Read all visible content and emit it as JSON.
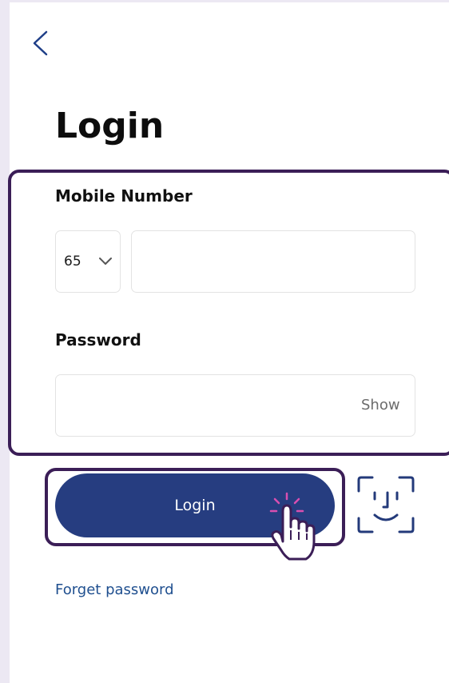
{
  "page": {
    "title": "Login"
  },
  "form": {
    "mobile_label": "Mobile Number",
    "country_code": "65",
    "phone_value": "",
    "password_label": "Password",
    "password_value": "",
    "show_label": "Show"
  },
  "actions": {
    "login_label": "Login",
    "forget_password_label": "Forget password"
  },
  "icons": {
    "back": "back-chevron-icon",
    "dropdown": "chevron-down-icon",
    "face_id": "face-id-icon",
    "cursor": "hand-pointer-icon"
  },
  "colors": {
    "primary_button": "#263d80",
    "link": "#1f4f8f",
    "highlight_border": "#3b1e57",
    "back_icon": "#1f3f88"
  }
}
